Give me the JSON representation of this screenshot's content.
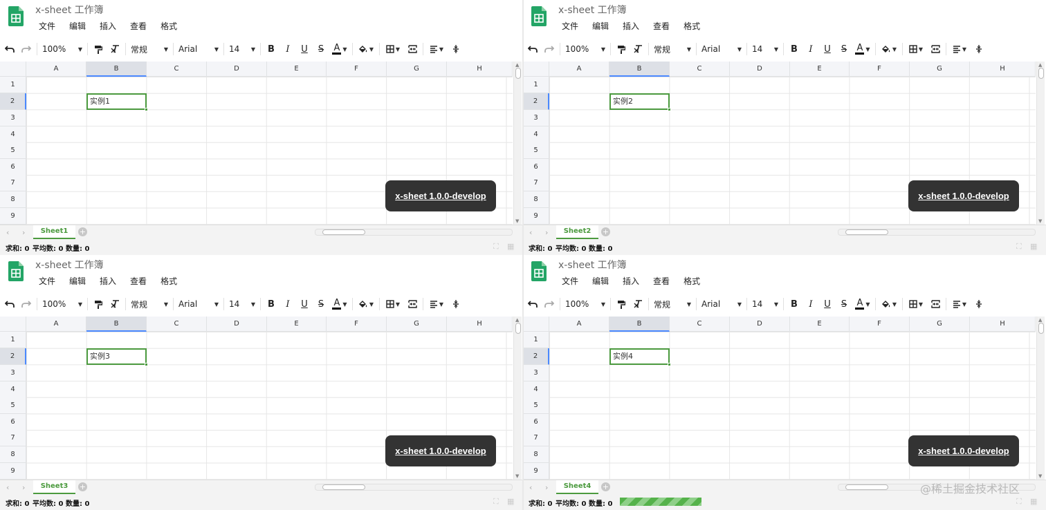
{
  "app": {
    "workbook_title": "x-sheet 工作簿",
    "menus": [
      "文件",
      "编辑",
      "插入",
      "查看",
      "格式"
    ]
  },
  "toolbar": {
    "zoom": "100%",
    "number_format": "常规",
    "font_family": "Arial",
    "font_size": "14",
    "icons": [
      "undo-icon",
      "redo-icon",
      "paint-format-icon",
      "clear-format-icon",
      "bold-icon",
      "italic-icon",
      "underline-icon",
      "strikethrough-icon",
      "text-color-icon",
      "fill-color-icon",
      "borders-icon",
      "merge-cells-icon",
      "align-horizontal-icon",
      "align-vertical-icon"
    ]
  },
  "grid": {
    "columns": [
      "A",
      "B",
      "C",
      "D",
      "E",
      "F",
      "G",
      "H"
    ],
    "rows": [
      "1",
      "2",
      "3",
      "4",
      "5",
      "6",
      "7",
      "8",
      "9"
    ],
    "selected_column": "B",
    "selected_row": "2"
  },
  "panes": [
    {
      "cell_text": "实例1",
      "sheet_tab": "Sheet1"
    },
    {
      "cell_text": "实例2",
      "sheet_tab": "Sheet2"
    },
    {
      "cell_text": "实例3",
      "sheet_tab": "Sheet3"
    },
    {
      "cell_text": "实例4",
      "sheet_tab": "Sheet4"
    }
  ],
  "badge": "x-sheet 1.0.0-develop",
  "status": {
    "sum": "求和: 0",
    "avg": "平均数: 0",
    "count": "数量: 0"
  },
  "progress_visible": true,
  "watermark": "@稀土掘金技术社区",
  "colors": {
    "accent_green": "#4b9a3e",
    "badge_bg": "#333333",
    "header_bg": "#f4f5f8",
    "logo_green": "#23a566"
  }
}
